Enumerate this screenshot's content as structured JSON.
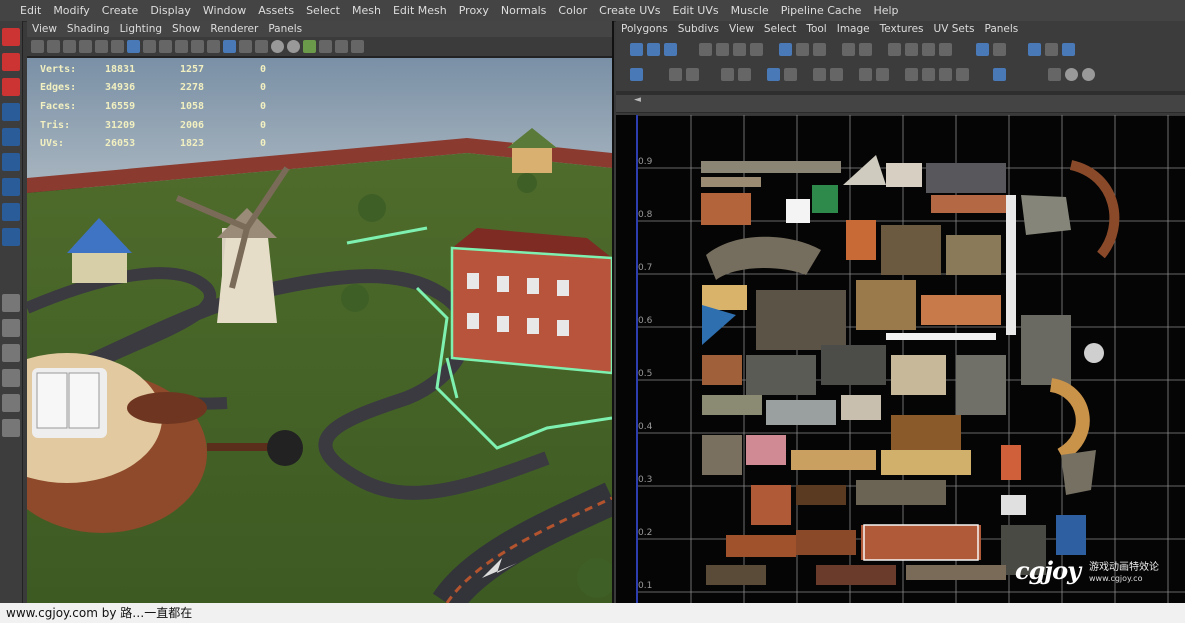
{
  "menubar": {
    "items": [
      "Edit",
      "Modify",
      "Create",
      "Display",
      "Window",
      "Assets",
      "Select",
      "Mesh",
      "Edit Mesh",
      "Proxy",
      "Normals",
      "Color",
      "Create UVs",
      "Edit UVs",
      "Muscle",
      "Pipeline Cache",
      "Help"
    ]
  },
  "viewport": {
    "menu": [
      "View",
      "Shading",
      "Lighting",
      "Show",
      "Renderer",
      "Panels"
    ],
    "hud": {
      "rows": [
        {
          "label": "Verts:",
          "total": "18831",
          "selected": "1257",
          "extra": "0"
        },
        {
          "label": "Edges:",
          "total": "34936",
          "selected": "2278",
          "extra": "0"
        },
        {
          "label": "Faces:",
          "total": "16559",
          "selected": "1058",
          "extra": "0"
        },
        {
          "label": "Tris:",
          "total": "31209",
          "selected": "2006",
          "extra": "0"
        },
        {
          "label": "UVs:",
          "total": "26053",
          "selected": "1823",
          "extra": "0"
        }
      ]
    }
  },
  "uv_editor": {
    "menu": [
      "Polygons",
      "Subdivs",
      "View",
      "Select",
      "Tool",
      "Image",
      "Textures",
      "UV Sets",
      "Panels"
    ],
    "scroll_marker": "◄",
    "ticks": [
      "0.9",
      "0.8",
      "0.7",
      "0.6",
      "0.5",
      "0.4",
      "0.3",
      "0.2",
      "0.1"
    ]
  },
  "status": {
    "text": "www.cgjoy.com by 路…一直都在"
  },
  "watermark": {
    "logo": "cgjoy",
    "cn_text": "游戏动画特效论",
    "url": "www.cgjoy.co"
  },
  "colors": {
    "wireframe": "#7ef0b0",
    "uv_axis": "#2d3fb0",
    "hud_text": "#f2f0c0"
  }
}
